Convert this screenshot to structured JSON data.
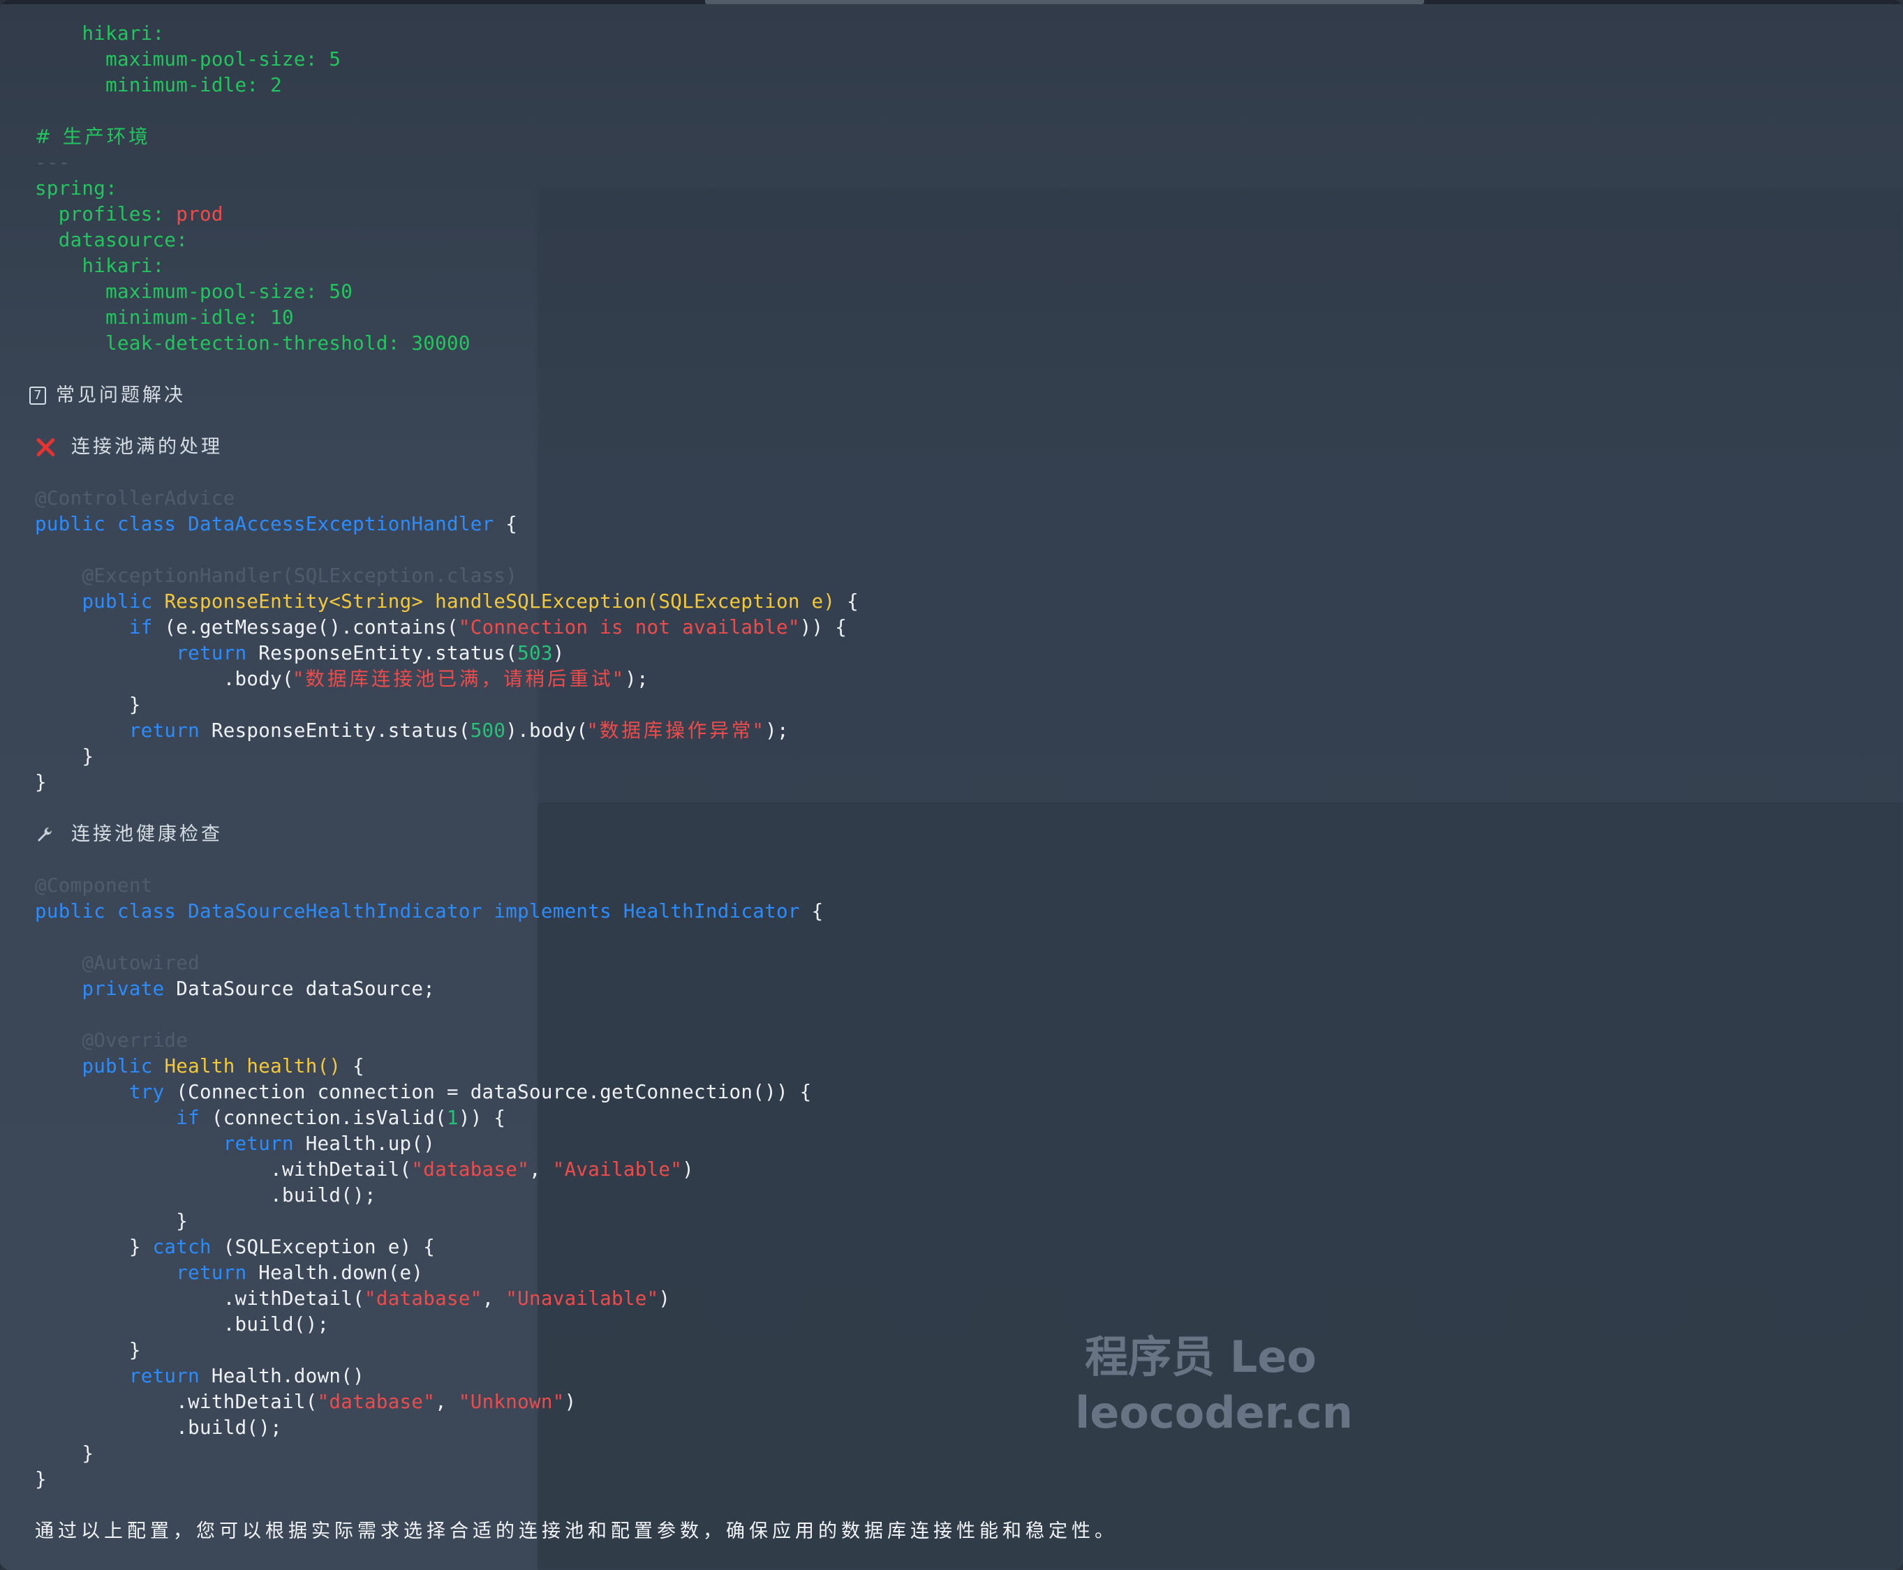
{
  "code_lines": {
    "l1": {
      "key": "hikari:"
    },
    "l2": {
      "key": "maximum-pool-size: 5"
    },
    "l3": {
      "key": "minimum-idle: 2"
    },
    "l5": {
      "comment": "# 生产环境"
    },
    "l6": {
      "sep": "---"
    },
    "l7": {
      "key": "spring:"
    },
    "l8": {
      "key": "profiles: ",
      "val": "prod"
    },
    "l9": {
      "key": "datasource:"
    },
    "l10": {
      "key": "hikari:"
    },
    "l11": {
      "key": "maximum-pool-size: 50"
    },
    "l12": {
      "key": "minimum-idle: 10"
    },
    "l13": {
      "key": "leak-detection-threshold: 30000"
    }
  },
  "sections": {
    "faq": {
      "label": "常见问题解决",
      "icon": "seven-icon",
      "icon_text": "7"
    },
    "pool_full": {
      "label": "连接池满的处理",
      "icon": "red-x-icon"
    },
    "health_check": {
      "label": "连接池健康检查",
      "icon": "wrench-icon"
    }
  },
  "java1": {
    "anno1": "@ControllerAdvice",
    "kw_public": "public",
    "kw_class": "class",
    "class_name": "DataAccessExceptionHandler",
    "brace_open": " {",
    "anno2": "@ExceptionHandler(SQLException.class)",
    "m_public": "public",
    "m_sig": "ResponseEntity<String> handleSQLException(SQLException e)",
    "m_open": " {",
    "if_kw": "if",
    "if_pre": " (e.getMessage().contains(",
    "if_str": "\"Connection is not available\"",
    "if_post": ")) {",
    "ret1_kw": "return",
    "ret1_pre": " ResponseEntity.status(",
    "ret1_num": "503",
    "ret1_post": ")",
    "body_pre": ".body(",
    "body_str": "\"数据库连接池已满，请稍后重试\"",
    "body_post": ");",
    "close_if": "}",
    "ret2_kw": "return",
    "ret2_pre": " ResponseEntity.status(",
    "ret2_num": "500",
    "ret2_mid": ").body(",
    "ret2_str": "\"数据库操作异常\"",
    "ret2_post": ");",
    "close_m": "}",
    "close_c": "}"
  },
  "java2": {
    "anno1": "@Component",
    "kw_public": "public",
    "kw_class": "class",
    "class_name": "DataSourceHealthIndicator",
    "kw_impl": "implements",
    "iface": "HealthIndicator",
    "brace_open": " {",
    "anno2": "@Autowired",
    "kw_private": "private",
    "field": " DataSource dataSource;",
    "anno3": "@Override",
    "m_public": "public",
    "m_sig": "Health health()",
    "m_open": " {",
    "try_kw": "try",
    "try_rest": " (Connection connection = dataSource.getConnection()) {",
    "if_kw": "if",
    "if_pre": " (connection.isValid(",
    "if_num": "1",
    "if_post": ")) {",
    "ret_up_kw": "return",
    "ret_up_rest": " Health.up()",
    "wd1_pre": ".withDetail(",
    "wd1_s1": "\"database\"",
    "wd1_comma": ", ",
    "wd1_s2": "\"Available\"",
    "wd1_post": ")",
    "build1": ".build();",
    "close_if": "}",
    "catch_pre": "} ",
    "catch_kw": "catch",
    "catch_rest": " (SQLException e) {",
    "ret_down_kw": "return",
    "ret_down_rest": " Health.down(e)",
    "wd2_pre": ".withDetail(",
    "wd2_s1": "\"database\"",
    "wd2_comma": ", ",
    "wd2_s2": "\"Unavailable\"",
    "wd2_post": ")",
    "build2": ".build();",
    "close_catch": "}",
    "ret_unk_kw": "return",
    "ret_unk_rest": " Health.down()",
    "wd3_pre": ".withDetail(",
    "wd3_s1": "\"database\"",
    "wd3_comma": ", ",
    "wd3_s2": "\"Unknown\"",
    "wd3_post": ")",
    "build3": ".build();",
    "close_m": "}",
    "close_c": "}"
  },
  "footer": {
    "text": "通过以上配置，您可以根据实际需求选择合适的连接池和配置参数，确保应用的数据库连接性能和稳定性。"
  },
  "watermark": {
    "line1": "程序员 Leo",
    "line2": "leocoder.cn"
  },
  "colors": {
    "keyword_blue": "#2b8cff",
    "type_yellow": "#f3c83a",
    "string_red": "#ef4b4b",
    "yaml_green": "#22c55e",
    "annotation_dim": "#4e5c6c"
  }
}
